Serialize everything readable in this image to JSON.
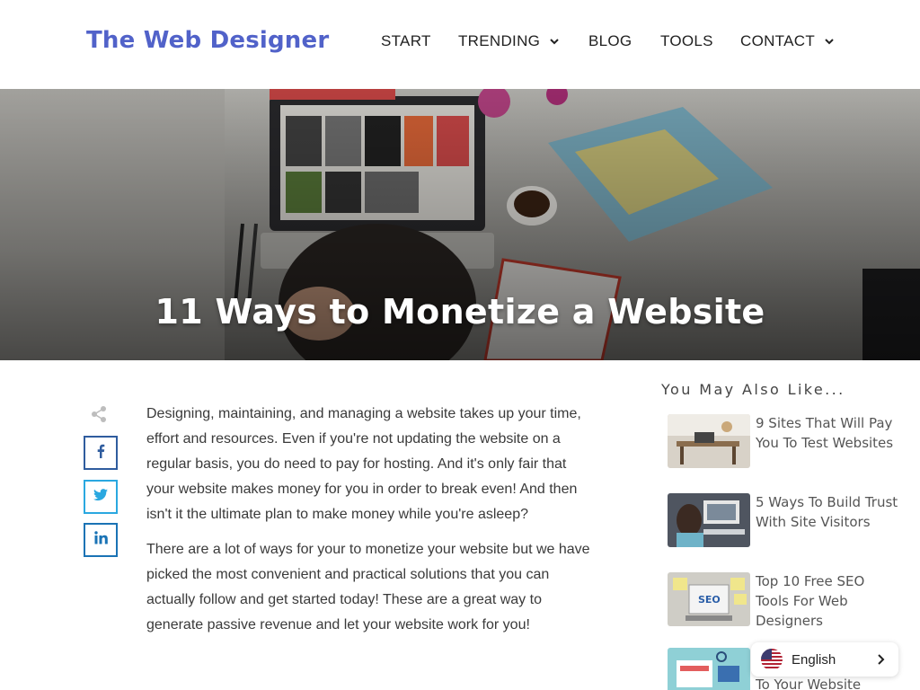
{
  "header": {
    "logo": "The Web Designer",
    "nav": [
      {
        "label": "START",
        "dropdown": false
      },
      {
        "label": "TRENDING",
        "dropdown": true
      },
      {
        "label": "BLOG",
        "dropdown": false
      },
      {
        "label": "TOOLS",
        "dropdown": false
      },
      {
        "label": "CONTACT",
        "dropdown": true
      }
    ]
  },
  "hero": {
    "title": "11 Ways to Monetize a Website"
  },
  "share": {
    "icons": [
      "share-icon",
      "facebook-icon",
      "twitter-icon",
      "linkedin-icon"
    ]
  },
  "article": {
    "paragraphs": [
      "Designing, maintaining, and managing a website takes up your time, effort and resources. Even if you're not updating the website on a regular basis, you do need to pay for hosting. And it's only fair that your website makes money for you in order to break even! And then isn't it the ultimate plan to make money while you're asleep?",
      "There are a lot of ways for your to monetize your website but we have picked the most convenient and practical solutions that you can actually follow and get started today! These are a great way to generate passive revenue and let your website work for you!"
    ]
  },
  "sidebar": {
    "title": "You May Also Like...",
    "items": [
      {
        "title": "9 Sites That Will Pay You To Test Websites"
      },
      {
        "title": "5 Ways To Build Trust With Site Visitors"
      },
      {
        "title": "Top 10 Free SEO Tools For Web Designers"
      },
      {
        "title": "To Your Website"
      }
    ]
  },
  "language": {
    "label": "English"
  },
  "colors": {
    "brand": "#5162c9",
    "facebook": "#2f5c9e",
    "twitter": "#2aa8e0",
    "linkedin": "#1a73b5"
  }
}
